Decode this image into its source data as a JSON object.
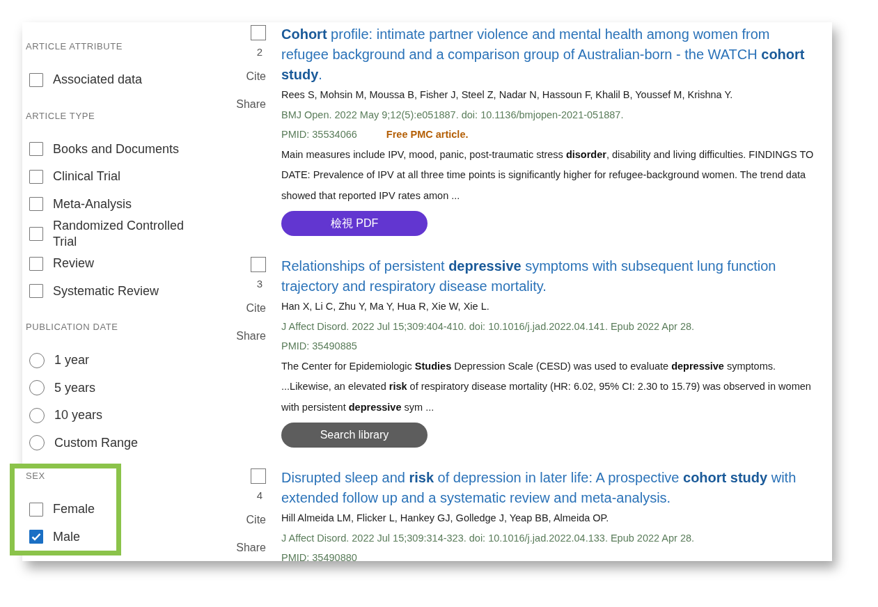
{
  "filters": [
    {
      "heading": "ARTICLE ATTRIBUTE",
      "kind": "checkbox",
      "highlighted": false,
      "options": [
        {
          "label": "Associated data",
          "checked": false
        }
      ]
    },
    {
      "heading": "ARTICLE TYPE",
      "kind": "checkbox",
      "highlighted": false,
      "options": [
        {
          "label": "Books and Documents",
          "checked": false
        },
        {
          "label": "Clinical Trial",
          "checked": false
        },
        {
          "label": "Meta-Analysis",
          "checked": false
        },
        {
          "label": "Randomized Controlled Trial",
          "checked": false
        },
        {
          "label": "Review",
          "checked": false
        },
        {
          "label": "Systematic Review",
          "checked": false
        }
      ]
    },
    {
      "heading": "PUBLICATION DATE",
      "kind": "radio",
      "highlighted": false,
      "options": [
        {
          "label": "1 year",
          "selected": false
        },
        {
          "label": "5 years",
          "selected": false
        },
        {
          "label": "10 years",
          "selected": false
        },
        {
          "label": "Custom Range",
          "selected": false
        }
      ]
    },
    {
      "heading": "SEX",
      "kind": "checkbox",
      "highlighted": true,
      "options": [
        {
          "label": "Female",
          "checked": false
        },
        {
          "label": "Male",
          "checked": true
        }
      ]
    }
  ],
  "results": [
    {
      "number": "2",
      "selected": false,
      "actions": [
        "Cite",
        "Share"
      ],
      "title": "**Cohort** profile: intimate partner violence and mental health among women from refugee background and a comparison group of Australian-born - the WATCH **cohort study**.",
      "authors": "Rees S, Mohsin M, Moussa B, Fisher J, Steel Z, Nadar N, Hassoun F, Khalil B, Youssef M, Krishna Y.",
      "citation": "BMJ Open. 2022 May 9;12(5):e051887. doi: 10.1136/bmjopen-2021-051887.",
      "pmid": "PMID: 35534066",
      "free": "Free PMC article.",
      "snippet": "Main measures include IPV, mood, panic, post-traumatic stress **disorder**, disability and living difficulties. FINDINGS TO DATE: Prevalence of IPV at all three time points is significantly higher for refugee-background women. The trend data showed that reported IPV rates amon ...",
      "button": {
        "label": "檢視 PDF",
        "kind": "pdf"
      }
    },
    {
      "number": "3",
      "selected": false,
      "actions": [
        "Cite",
        "Share"
      ],
      "title": "Relationships of persistent **depressive** symptoms with subsequent lung function trajectory and respiratory disease mortality.",
      "authors": "Han X, Li C, Zhu Y, Ma Y, Hua R, Xie W, Xie L.",
      "citation": "J Affect Disord. 2022 Jul 15;309:404-410. doi: 10.1016/j.jad.2022.04.141. Epub 2022 Apr 28.",
      "pmid": "PMID: 35490885",
      "snippet": "The Center for Epidemiologic **Studies** Depression Scale (CESD) was used to evaluate **depressive** symptoms. ...Likewise, an elevated **risk** of respiratory disease mortality (HR: 6.02, 95% CI: 2.30 to 15.79) was observed in women with persistent **depressive** sym ...",
      "button": {
        "label": "Search library",
        "kind": "library"
      }
    },
    {
      "number": "4",
      "selected": false,
      "actions": [
        "Cite",
        "Share"
      ],
      "title": "Disrupted sleep and **risk** of depression in later life: A prospective **cohort study** with extended follow up and a systematic review and meta-analysis.",
      "authors": "Hill Almeida LM, Flicker L, Hankey GJ, Golledge J, Yeap BB, Almeida OP.",
      "citation": "J Affect Disord. 2022 Jul 15;309:314-323. doi: 10.1016/j.jad.2022.04.133. Epub 2022 Apr 28.",
      "pmid": "PMID: 35490880"
    }
  ]
}
